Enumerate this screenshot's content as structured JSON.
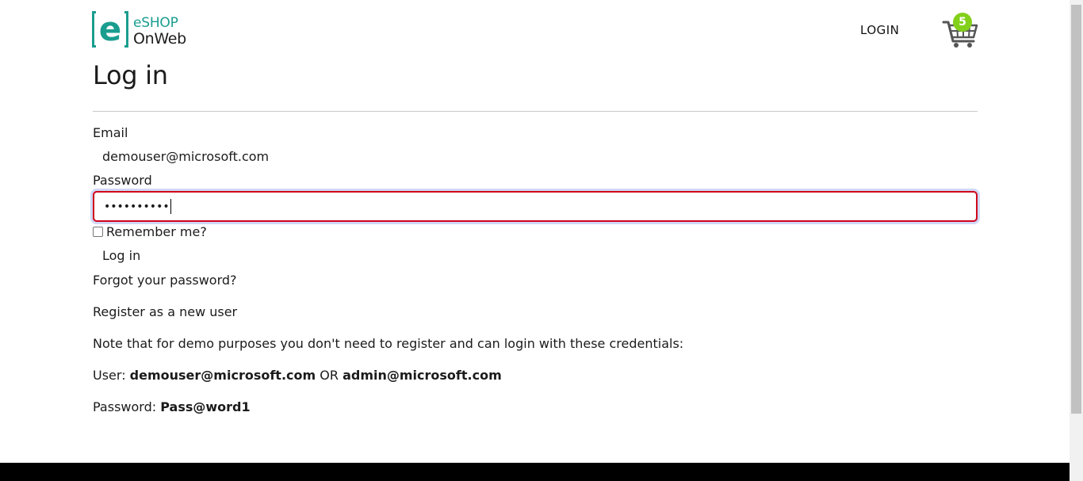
{
  "brand": {
    "line1": "eSHOP",
    "line2": "OnWeb",
    "mark_letter": "e",
    "color": "#1a9d8f"
  },
  "header": {
    "login_label": "LOGIN",
    "cart_count": "5",
    "badge_color": "#83d01b"
  },
  "page": {
    "title": "Log in"
  },
  "form": {
    "email_label": "Email",
    "email_value": "demouser@microsoft.com",
    "password_label": "Password",
    "password_masked": "••••••••••",
    "remember_label": "Remember me?",
    "submit_label": "Log in",
    "forgot_link": "Forgot your password?",
    "register_link": "Register as a new user"
  },
  "notes": {
    "demo_note": "Note that for demo purposes you don't need to register and can login with these credentials:",
    "user_prefix": "User:",
    "user1": "demouser@microsoft.com",
    "or": "OR",
    "user2": "admin@microsoft.com",
    "password_prefix": "Password:",
    "password": "Pass@word1"
  },
  "colors": {
    "error_border": "#d0021b",
    "focus_ring": "#cfd8f6",
    "footer": "#000000"
  }
}
